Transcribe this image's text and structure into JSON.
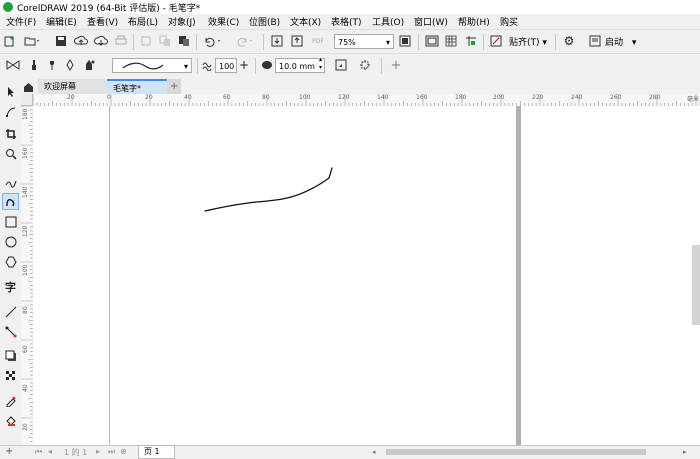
{
  "window": {
    "title": "CorelDRAW 2019 (64-Bit 评估版) - 毛笔字*"
  },
  "menu": [
    "文件(F)",
    "编辑(E)",
    "查看(V)",
    "布局(L)",
    "对象(J)",
    "效果(C)",
    "位图(B)",
    "文本(X)",
    "表格(T)",
    "工具(O)",
    "窗口(W)",
    "帮助(H)",
    "购买"
  ],
  "toolbar": {
    "zoom_value": "75%",
    "snap_label": "贴齐(T)",
    "launch_label": "启动"
  },
  "property_bar": {
    "smoothing_value": "100",
    "width_value": "10.0 mm"
  },
  "tabs": {
    "welcome": "欢迎屏幕",
    "document": "毛笔字*",
    "add": "+"
  },
  "hruler": [
    "20",
    "0",
    "20",
    "40",
    "60",
    "80",
    "100",
    "120",
    "140",
    "160",
    "180",
    "200",
    "220",
    "240",
    "260",
    "280",
    "毫米"
  ],
  "vruler": [
    "180",
    "160",
    "140",
    "120",
    "100",
    "80",
    "60",
    "40",
    "20"
  ],
  "pager": {
    "position": "1 的 1",
    "page_tab": "页 1"
  },
  "colors": {
    "accent": "#1e9d3c",
    "canvas": "#ffffff",
    "page_border": "#b0b0b0"
  }
}
